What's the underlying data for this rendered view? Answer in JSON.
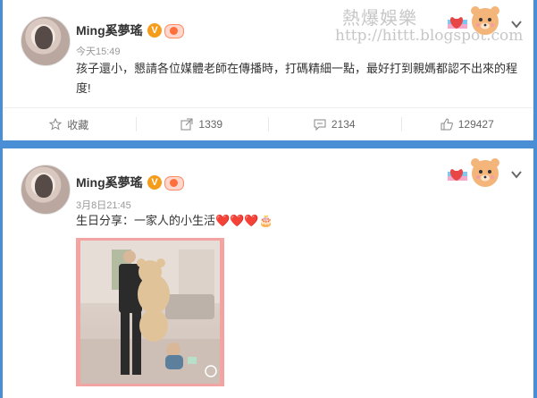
{
  "watermark": {
    "title": "熱爆娛樂",
    "url": "http://hittt.blogspot.com"
  },
  "posts": [
    {
      "username": "Ming奚夢瑤",
      "verified_badge": "V",
      "timestamp": "今天15:49",
      "text": "孩子還小，懇請各位媒體老師在傳播時，打碼精細一點，最好打到親媽都認不出來的程度!",
      "actions": {
        "favorite_label": "收藏",
        "repost_count": "1339",
        "comment_count": "2134",
        "like_count": "129427"
      }
    },
    {
      "username": "Ming奚夢瑤",
      "verified_badge": "V",
      "timestamp": "3月8日21:45",
      "text": "生日分享：一家人的小生活❤️❤️❤️🎂"
    }
  ],
  "colors": {
    "page_background": "#4a8fd6",
    "card_background": "#ffffff",
    "username": "#333333",
    "timestamp": "#999999",
    "verified": "#f59d1a",
    "media_frame": "#f4a3a3"
  },
  "icons": [
    "star-icon",
    "repost-icon",
    "comment-icon",
    "like-icon",
    "chevron-down-icon",
    "verified-icon",
    "fan-badge-icon",
    "bear-mascot-icon"
  ]
}
